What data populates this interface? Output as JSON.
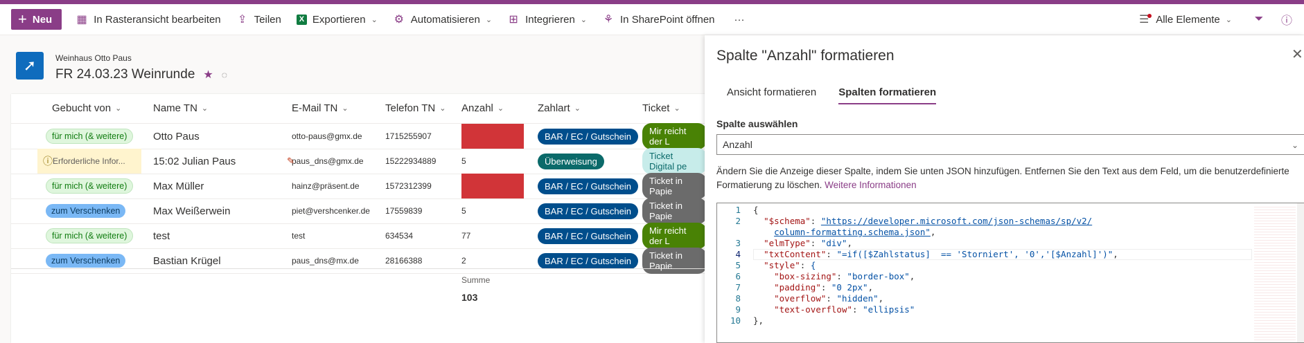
{
  "cmdbar": {
    "new_label": "Neu",
    "grid_label": "In Rasteransicht bearbeiten",
    "share_label": "Teilen",
    "export_label": "Exportieren",
    "automate_label": "Automatisieren",
    "integrate_label": "Integrieren",
    "sharepoint_label": "In SharePoint öffnen",
    "more_label": "···",
    "view_label": "Alle Elemente"
  },
  "header": {
    "site_name": "Weinhaus Otto Paus",
    "list_title": "FR 24.03.23 Weinrunde"
  },
  "columns": [
    "Gebucht von",
    "Name TN",
    "E-Mail TN",
    "Telefon TN",
    "Anzahl",
    "Zahlart",
    "Ticket"
  ],
  "rows": [
    {
      "gebucht": "für mich (& weitere)",
      "gebucht_style": "green",
      "name": "Otto Paus",
      "email": "otto-paus@gmx.de",
      "telefon": "1715255907",
      "anzahl": "",
      "anzahl_red": true,
      "zahlart": "BAR / EC / Gutschein",
      "zahlart_style": "dark",
      "ticket": "Mir reicht der L",
      "ticket_style": "lime"
    },
    {
      "gebucht": "Erforderliche Infor...",
      "gebucht_style": "warn",
      "name": "15:02 Julian Paus",
      "email": "paus_dns@gmx.de",
      "telefon": "15222934889",
      "anzahl": "5",
      "anzahl_red": false,
      "zahlart": "Überweisung",
      "zahlart_style": "teal",
      "ticket": "Ticket Digital pe",
      "ticket_style": "lteal"
    },
    {
      "gebucht": "für mich (& weitere)",
      "gebucht_style": "green",
      "name": "Max Müller",
      "email": "hainz@präsent.de",
      "telefon": "1572312399",
      "anzahl": "",
      "anzahl_red": true,
      "zahlart": "BAR / EC / Gutschein",
      "zahlart_style": "dark",
      "ticket": "Ticket in Papie",
      "ticket_style": "grey"
    },
    {
      "gebucht": "zum Verschenken",
      "gebucht_style": "blue",
      "name": "Max Weißerwein",
      "email": "piet@vershcenker.de",
      "telefon": "17559839",
      "anzahl": "5",
      "anzahl_red": false,
      "zahlart": "BAR / EC / Gutschein",
      "zahlart_style": "dark",
      "ticket": "Ticket in Papie",
      "ticket_style": "grey"
    },
    {
      "gebucht": "für mich (& weitere)",
      "gebucht_style": "green",
      "name": "test",
      "email": "test",
      "telefon": "634534",
      "anzahl": "77",
      "anzahl_red": false,
      "zahlart": "BAR / EC / Gutschein",
      "zahlart_style": "dark",
      "ticket": "Mir reicht der L",
      "ticket_style": "lime"
    },
    {
      "gebucht": "zum Verschenken",
      "gebucht_style": "blue",
      "name": "Bastian Krügel",
      "email": "paus_dns@mx.de",
      "telefon": "28166388",
      "anzahl": "2",
      "anzahl_red": false,
      "zahlart": "BAR / EC / Gutschein",
      "zahlart_style": "dark",
      "ticket": "Ticket in Papie",
      "ticket_style": "grey"
    }
  ],
  "summary": {
    "label": "Summe",
    "value": "103"
  },
  "panel": {
    "title": "Spalte \"Anzahl\" formatieren",
    "tab_view": "Ansicht formatieren",
    "tab_column": "Spalten formatieren",
    "select_label": "Spalte auswählen",
    "select_value": "Anzahl",
    "description": "Ändern Sie die Anzeige dieser Spalte, indem Sie unten JSON hinzufügen. Entfernen Sie den Text aus dem Feld, um die benutzerdefinierte Formatierung zu löschen.",
    "more_info": "Weitere Informationen"
  },
  "code_lines": [
    {
      "n": "1",
      "text": "{"
    },
    {
      "n": "2",
      "key": "\"$schema\"",
      "sep": ": ",
      "val": "\"https://developer.microsoft.com/json-schemas/sp/v2/"
    },
    {
      "n": "",
      "cont": "column-formatting.schema.json\"",
      "tail": ","
    },
    {
      "n": "3",
      "key": "\"elmType\"",
      "sep": ": ",
      "val": "\"div\"",
      "tail": ","
    },
    {
      "n": "4",
      "key": "\"txtContent\"",
      "sep": ": ",
      "val": "\"=if([$Zahlstatus]  == 'Storniert', '0','[$Anzahl]')\"",
      "tail": ","
    },
    {
      "n": "5",
      "key": "\"style\"",
      "sep": ": ",
      "val": "{"
    },
    {
      "n": "6",
      "key": "\"box-sizing\"",
      "sep": ": ",
      "val": "\"border-box\"",
      "tail": ","
    },
    {
      "n": "7",
      "key": "\"padding\"",
      "sep": ": ",
      "val": "\"0 2px\"",
      "tail": ","
    },
    {
      "n": "8",
      "key": "\"overflow\"",
      "sep": ": ",
      "val": "\"hidden\"",
      "tail": ","
    },
    {
      "n": "9",
      "key": "\"text-overflow\"",
      "sep": ": ",
      "val": "\"ellipsis\""
    },
    {
      "n": "10",
      "text": "},"
    }
  ],
  "colors": {
    "brand": "#8a3d87",
    "red": "#d13438"
  }
}
